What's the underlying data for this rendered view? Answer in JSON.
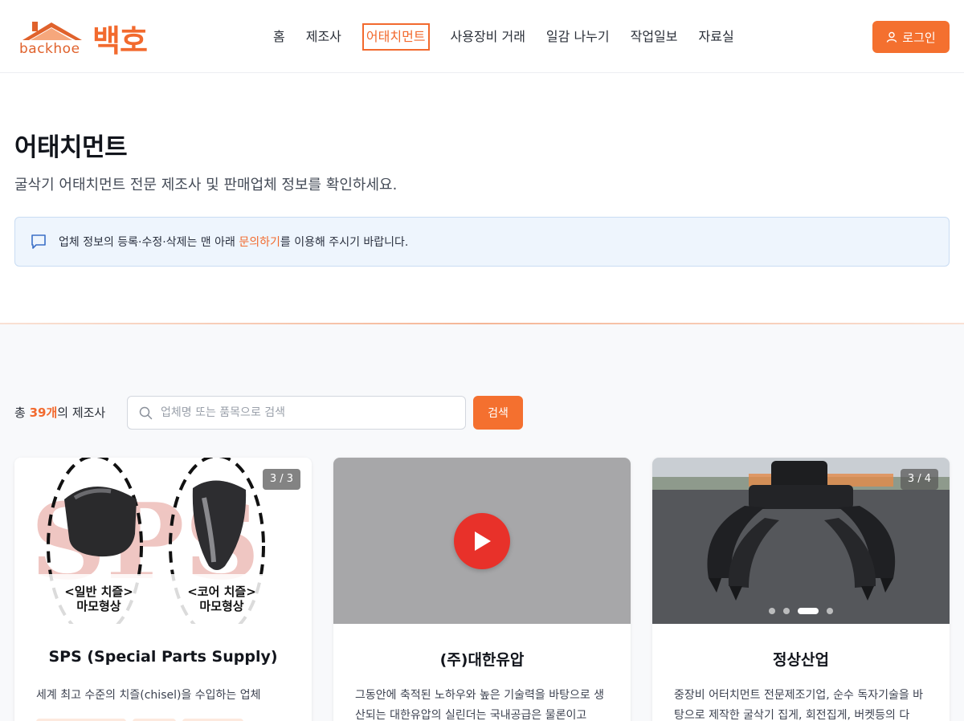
{
  "header": {
    "logo_en": "backhoe",
    "logo_ko": "백호",
    "nav": [
      {
        "label": "홈",
        "active": false
      },
      {
        "label": "제조사",
        "active": false
      },
      {
        "label": "어태치먼트",
        "active": true
      },
      {
        "label": "사용장비 거래",
        "active": false
      },
      {
        "label": "일감 나누기",
        "active": false
      },
      {
        "label": "작업일보",
        "active": false
      },
      {
        "label": "자료실",
        "active": false
      }
    ],
    "login_label": "로그인"
  },
  "hero": {
    "title": "어태치먼트",
    "subtitle": "굴삭기 어태치먼트 전문 제조사 및 판매업체 정보를 확인하세요."
  },
  "notice": {
    "text_before": "업체 정보의 등록·수정·삭제는 맨 아래 ",
    "link": "문의하기",
    "text_after": "를 이용해 주시기 바랍니다."
  },
  "listing": {
    "count_prefix": "총 ",
    "count_value": "39개",
    "count_suffix": "의 제조사",
    "search_placeholder": "업체명 또는 품목으로 검색",
    "search_button": "검색"
  },
  "cards": [
    {
      "name": "SPS (Special Parts Supply)",
      "description": "세계 최고 수준의 치즐(chisel)을 수입하는 업체",
      "badge": "3 / 3",
      "image": {
        "watermark": "SPS",
        "caption_left_1": "<일반 치즐>",
        "caption_left_2": "마모형상",
        "caption_right_1": "<코어 치즐>",
        "caption_right_2": "마모형상"
      }
    },
    {
      "name": "(주)대한유압",
      "description": "그동안에 축적된 노하우와 높은 기술력을 바탕으로 생산되는 대한유압의 실린더는 국내공급은 물론이고",
      "media": "video"
    },
    {
      "name": "정상산업",
      "description": "중장비 어터치먼트 전문제조기업, 순수 독자기술을 바탕으로 제작한 굴삭기 집게, 회전집게, 버켓등의 다",
      "badge": "3 / 4"
    }
  ],
  "colors": {
    "accent": "#f4702f",
    "notice_bg": "#eef5fd",
    "play": "#e8312a"
  }
}
